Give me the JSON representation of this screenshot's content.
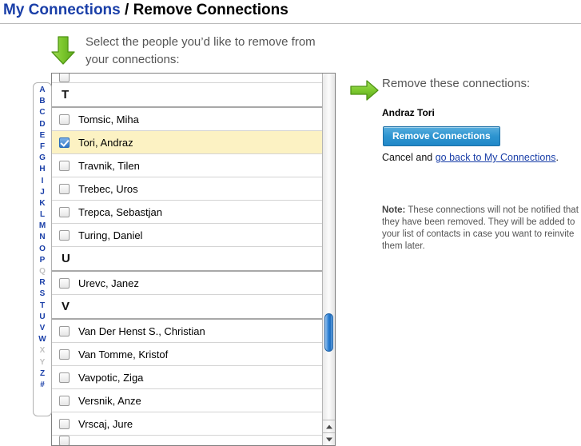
{
  "header": {
    "breadcrumb_primary": "My Connections",
    "breadcrumb_separator": " / ",
    "breadcrumb_current": "Remove Connections"
  },
  "instruction": {
    "arrow_icon": "arrow-down-green-icon",
    "text": "Select the people you’d like to remove from your connections:"
  },
  "alphabet_index": [
    {
      "letter": "A",
      "enabled": true
    },
    {
      "letter": "B",
      "enabled": true
    },
    {
      "letter": "C",
      "enabled": true
    },
    {
      "letter": "D",
      "enabled": true
    },
    {
      "letter": "E",
      "enabled": true
    },
    {
      "letter": "F",
      "enabled": true
    },
    {
      "letter": "G",
      "enabled": true
    },
    {
      "letter": "H",
      "enabled": true
    },
    {
      "letter": "I",
      "enabled": true
    },
    {
      "letter": "J",
      "enabled": true
    },
    {
      "letter": "K",
      "enabled": true
    },
    {
      "letter": "L",
      "enabled": true
    },
    {
      "letter": "M",
      "enabled": true
    },
    {
      "letter": "N",
      "enabled": true
    },
    {
      "letter": "O",
      "enabled": true
    },
    {
      "letter": "P",
      "enabled": true
    },
    {
      "letter": "Q",
      "enabled": false
    },
    {
      "letter": "R",
      "enabled": true
    },
    {
      "letter": "S",
      "enabled": true
    },
    {
      "letter": "T",
      "enabled": true
    },
    {
      "letter": "U",
      "enabled": true
    },
    {
      "letter": "V",
      "enabled": true
    },
    {
      "letter": "W",
      "enabled": true
    },
    {
      "letter": "X",
      "enabled": false
    },
    {
      "letter": "Y",
      "enabled": false
    },
    {
      "letter": "Z",
      "enabled": true
    },
    {
      "letter": "#",
      "enabled": true
    }
  ],
  "connections_list": [
    {
      "kind": "person",
      "name": "",
      "checked": false,
      "partial": "top"
    },
    {
      "kind": "group",
      "label": "T"
    },
    {
      "kind": "person",
      "name": "Tomsic, Miha",
      "checked": false
    },
    {
      "kind": "person",
      "name": "Tori, Andraz",
      "checked": true
    },
    {
      "kind": "person",
      "name": "Travnik, Tilen",
      "checked": false
    },
    {
      "kind": "person",
      "name": "Trebec, Uros",
      "checked": false
    },
    {
      "kind": "person",
      "name": "Trepca, Sebastjan",
      "checked": false
    },
    {
      "kind": "person",
      "name": "Turing, Daniel",
      "checked": false
    },
    {
      "kind": "group",
      "label": "U"
    },
    {
      "kind": "person",
      "name": "Urevc, Janez",
      "checked": false
    },
    {
      "kind": "group",
      "label": "V"
    },
    {
      "kind": "person",
      "name": "Van Der Henst S., Christian",
      "checked": false
    },
    {
      "kind": "person",
      "name": "Van Tomme, Kristof",
      "checked": false
    },
    {
      "kind": "person",
      "name": "Vavpotic, Ziga",
      "checked": false
    },
    {
      "kind": "person",
      "name": "Versnik, Anze",
      "checked": false
    },
    {
      "kind": "person",
      "name": "Vrscaj, Jure",
      "checked": false
    },
    {
      "kind": "person",
      "name": "",
      "checked": false,
      "partial": "bottom"
    }
  ],
  "scrollbar": {
    "up_arrow_icon": "triangle-up-icon",
    "down_arrow_icon": "triangle-down-icon",
    "thumb_position_percent": 78
  },
  "right_pane": {
    "arrow_icon": "arrow-right-green-icon",
    "heading": "Remove these connections:",
    "selected_names": "Andraz Tori",
    "remove_button_label": "Remove Connections",
    "cancel_prefix": "Cancel and ",
    "cancel_link_label": "go back to My Connections",
    "cancel_suffix": ".",
    "note_label": "Note:",
    "note_text": " These connections will not be notified that they have been removed. They will be added to your list of contacts in case you want to reinvite them later."
  },
  "colors": {
    "link_blue": "#1a3fa8",
    "selected_row_yellow": "#fcf2c3",
    "button_blue": "#2d94d0",
    "arrow_green": "#7ac943",
    "scroll_thumb_blue": "#2b7fd4"
  }
}
